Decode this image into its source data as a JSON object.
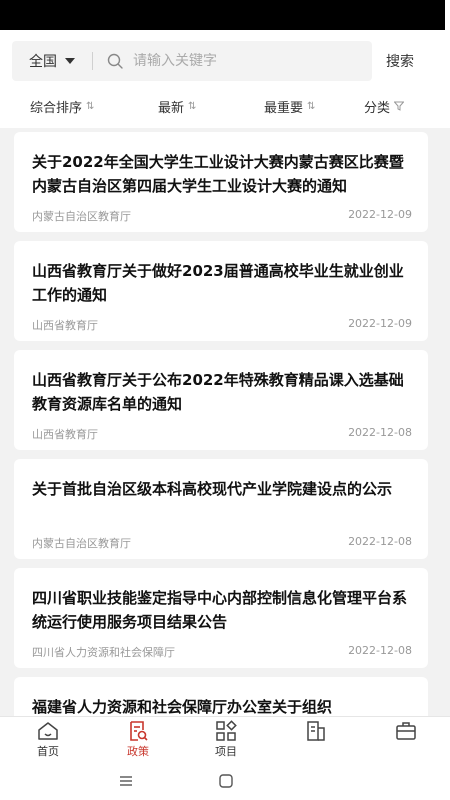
{
  "search": {
    "region": "全国",
    "placeholder": "请输入关键字",
    "button_label": "搜索"
  },
  "sort": {
    "items": [
      {
        "label": "综合排序"
      },
      {
        "label": "最新"
      },
      {
        "label": "最重要"
      },
      {
        "label": "分类"
      }
    ]
  },
  "articles": [
    {
      "title": "关于2022年全国大学生工业设计大赛内蒙古赛区比赛暨内蒙古自治区第四届大学生工业设计大赛的通知",
      "source": "内蒙古自治区教育厅",
      "date": "2022-12-09"
    },
    {
      "title": "山西省教育厅关于做好2023届普通高校毕业生就业创业工作的通知",
      "source": "山西省教育厅",
      "date": "2022-12-09"
    },
    {
      "title": "山西省教育厅关于公布2022年特殊教育精品课入选基础教育资源库名单的通知",
      "source": "山西省教育厅",
      "date": "2022-12-08"
    },
    {
      "title": "关于首批自治区级本科高校现代产业学院建设点的公示",
      "source": "内蒙古自治区教育厅",
      "date": "2022-12-08"
    },
    {
      "title": "四川省职业技能鉴定指导中心内部控制信息化管理平台系统运行使用服务项目结果公告",
      "source": "四川省人力资源和社会保障厅",
      "date": "2022-12-08"
    },
    {
      "title": "福建省人力资源和社会保障厅办公室关于组织",
      "source": "",
      "date": ""
    }
  ],
  "tabbar": {
    "tabs": [
      {
        "label": "首页",
        "icon": "home-icon"
      },
      {
        "label": "政策",
        "icon": "policy-icon",
        "active": true
      },
      {
        "label": "项目",
        "icon": "grid-icon"
      },
      {
        "label": "",
        "icon": "building-icon"
      },
      {
        "label": "",
        "icon": "briefcase-icon"
      }
    ]
  },
  "colors": {
    "accent": "#c8372d",
    "background": "#f2f2f2"
  }
}
